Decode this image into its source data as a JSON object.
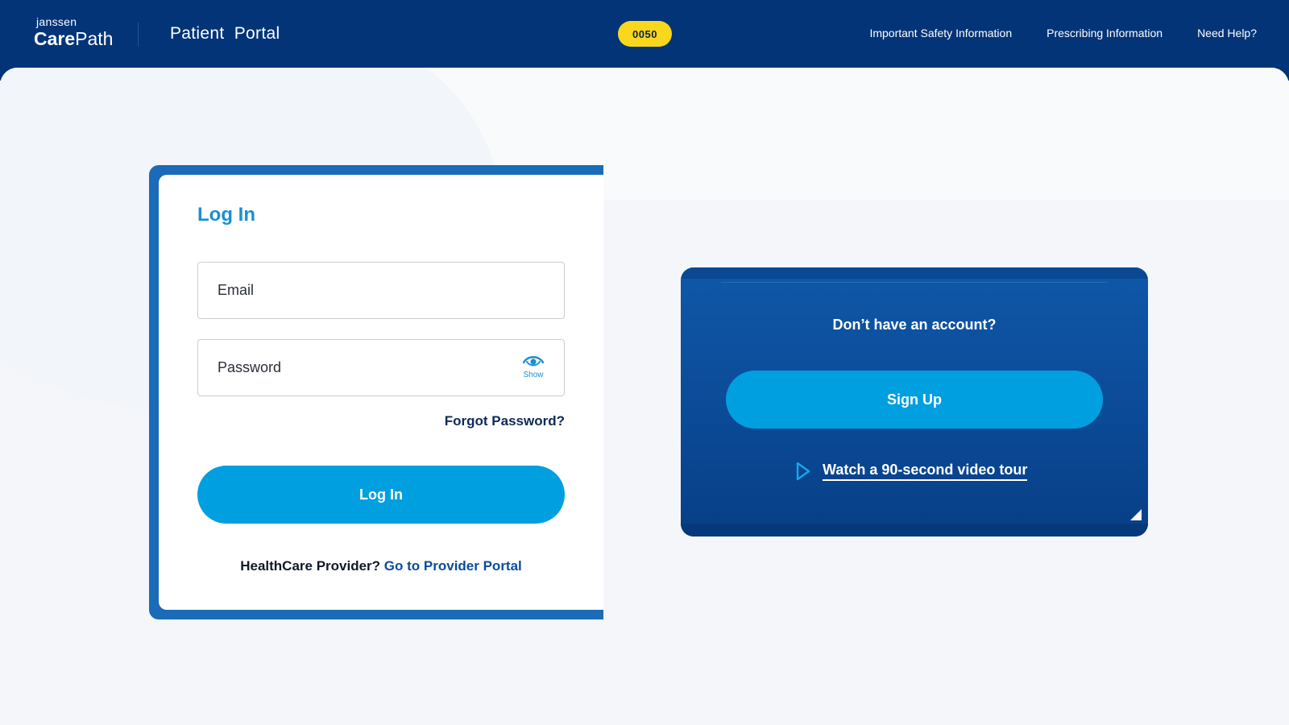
{
  "header": {
    "logo_top": "janssen",
    "logo_care": "Care",
    "logo_path": "Path",
    "portal_title": "Patient  Portal",
    "badge": "0050",
    "nav": [
      {
        "label": "Important Safety Information"
      },
      {
        "label": "Prescribing Information"
      },
      {
        "label": "Need Help?"
      }
    ]
  },
  "login": {
    "title": "Log In",
    "email_placeholder": "Email",
    "password_placeholder": "Password",
    "show_label": "Show",
    "forgot_label": "Forgot Password?",
    "button_label": "Log In",
    "provider_prefix": "HealthCare Provider?",
    "provider_link": "Go to Provider Portal"
  },
  "signup": {
    "question": "Don’t have an account?",
    "button_label": "Sign Up",
    "video_label": "Watch a 90-second video tour"
  },
  "icons": {
    "show_password": "eye-icon",
    "video": "play-icon"
  },
  "colors": {
    "header_bg": "#033478",
    "accent": "#009fe0",
    "badge": "#f9d71c",
    "card_frame": "#1a6bb8",
    "signup_bg": "#0b4a97"
  }
}
